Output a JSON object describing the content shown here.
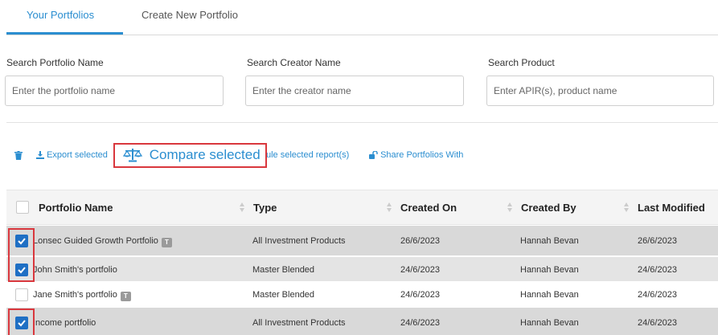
{
  "tabs": [
    {
      "label": "Your Portfolios",
      "active": true
    },
    {
      "label": "Create New Portfolio",
      "active": false
    }
  ],
  "search": {
    "portfolio": {
      "label": "Search Portfolio Name",
      "placeholder": "Enter the portfolio name"
    },
    "creator": {
      "label": "Search Creator Name",
      "placeholder": "Enter the creator name"
    },
    "product": {
      "label": "Search Product",
      "placeholder": "Enter APIR(s), product name"
    }
  },
  "toolbar": {
    "export_label": "Export selected",
    "compare_label": "Compare selected",
    "schedule_label": "ule selected report(s)",
    "share_label": "Share Portfolios With"
  },
  "table": {
    "headers": [
      "Portfolio Name",
      "Type",
      "Created On",
      "Created By",
      "Last Modified"
    ],
    "rows": [
      {
        "name": "Lonsec Guided Growth Portfolio",
        "tag": "T",
        "type": "All Investment Products",
        "created_on": "26/6/2023",
        "created_by": "Hannah Bevan",
        "last_modified": "26/6/2023",
        "checked": true
      },
      {
        "name": "John Smith's portfolio",
        "tag": "",
        "type": "Master Blended",
        "created_on": "24/6/2023",
        "created_by": "Hannah Bevan",
        "last_modified": "24/6/2023",
        "checked": true
      },
      {
        "name": "Jane Smith's portfolio",
        "tag": "T",
        "type": "Master Blended",
        "created_on": "24/6/2023",
        "created_by": "Hannah Bevan",
        "last_modified": "24/6/2023",
        "checked": false
      },
      {
        "name": "Income portfolio",
        "tag": "",
        "type": "All Investment Products",
        "created_on": "24/6/2023",
        "created_by": "Hannah Bevan",
        "last_modified": "24/6/2023",
        "checked": true
      }
    ]
  },
  "colors": {
    "accent": "#2b8ed0",
    "highlight": "#d9373d",
    "checkbox": "#1f6fc4",
    "row_shade": "#d9d9d9"
  }
}
